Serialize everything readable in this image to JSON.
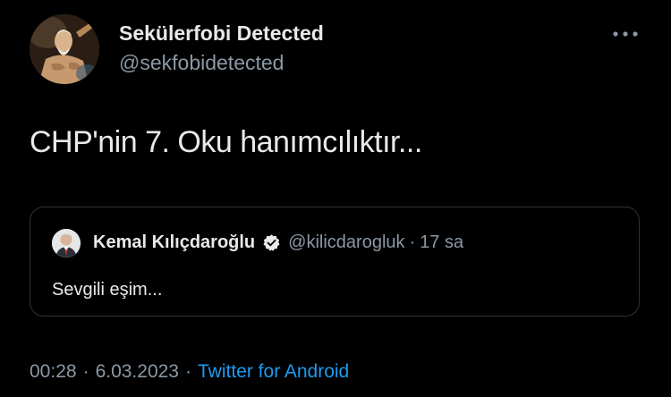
{
  "author": {
    "display_name": "Sekülerfobi Detected",
    "handle": "@sekfobidetected",
    "avatar_icon": "classical-painting-avatar"
  },
  "more_icon": "more-options-icon",
  "tweet": {
    "text": "CHP'nin 7. Oku hanımcılıktır..."
  },
  "quoted": {
    "display_name": "Kemal Kılıçdaroğlu",
    "handle": "@kilicdarogluk",
    "separator": "·",
    "time": "17 sa",
    "text": "Sevgili eşim...",
    "verified_icon": "verified-badge-icon"
  },
  "meta": {
    "time": "00:28",
    "separator": "·",
    "date": "6.03.2023",
    "source": "Twitter for Android"
  },
  "colors": {
    "background": "#000000",
    "primary_text": "#e7e9ea",
    "secondary_text": "#8b98a5",
    "link": "#1d9bf0",
    "border": "#2f3336"
  }
}
